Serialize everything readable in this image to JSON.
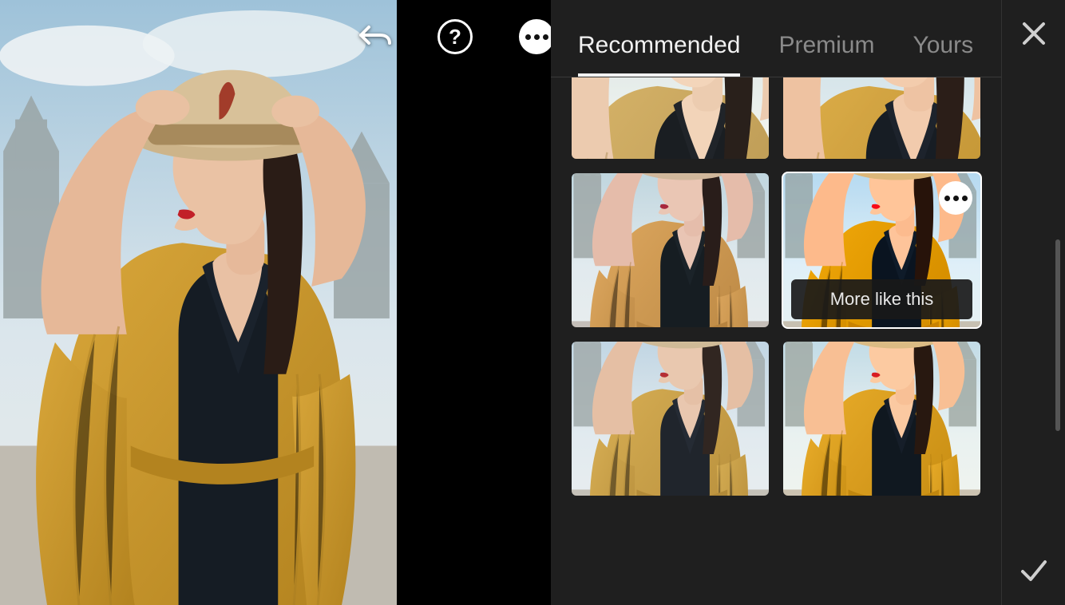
{
  "icons": {
    "undo": "undo-icon",
    "help": "?",
    "more": "more-icon",
    "close": "close-icon",
    "confirm": "checkmark-icon"
  },
  "tabs": [
    {
      "id": "recommended",
      "label": "Recommended",
      "active": true
    },
    {
      "id": "premium",
      "label": "Premium",
      "active": false
    },
    {
      "id": "yours",
      "label": "Yours",
      "active": false
    }
  ],
  "presets": [
    {
      "id": 0,
      "filter": "f-warm-desat",
      "selected": false,
      "row0": true
    },
    {
      "id": 1,
      "filter": "f-warm",
      "selected": false,
      "row0": true
    },
    {
      "id": 2,
      "filter": "f-cool-muted",
      "selected": false,
      "row0": false
    },
    {
      "id": 3,
      "filter": "f-vivid",
      "selected": true,
      "row0": false,
      "caption": "More like this"
    },
    {
      "id": 4,
      "filter": "f-soft",
      "selected": false,
      "row0": false
    },
    {
      "id": 5,
      "filter": "f-warm-vivid",
      "selected": false,
      "row0": false
    }
  ],
  "colors": {
    "panel": "#1f1f1f",
    "textActive": "#f2f2f2",
    "textInactive": "#8a8a8a"
  }
}
